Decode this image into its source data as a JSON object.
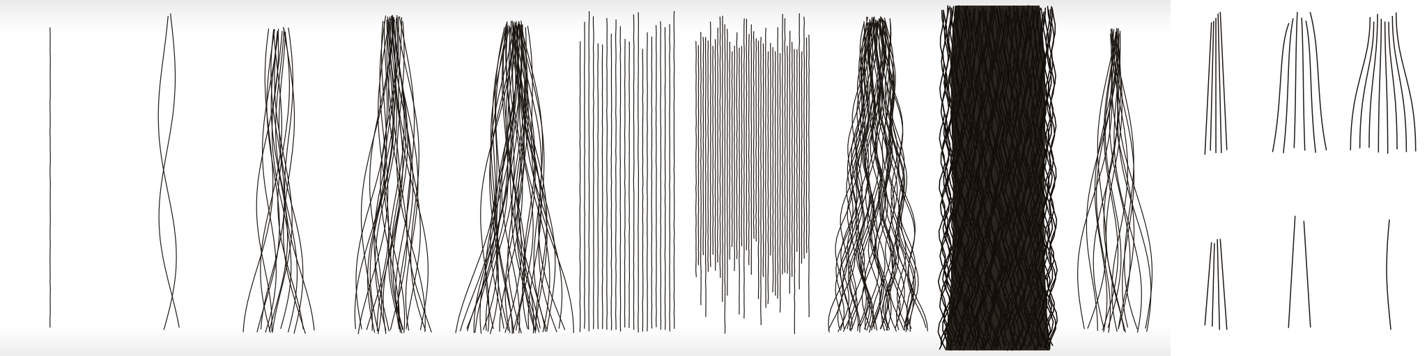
{
  "figure": {
    "background": "#ffffff",
    "ink": "#1c1712",
    "main_panel": {
      "columns": [
        {
          "name": "single-straight-strand",
          "strands": 1,
          "wave": 0,
          "spread": 0,
          "tip_taper": 0.0,
          "density": "single"
        },
        {
          "name": "single-wavy-strand",
          "strands": 2,
          "wave": 1,
          "spread": 0.05,
          "tip_taper": 0.0,
          "density": "sparse"
        },
        {
          "name": "wavy-bundle-sparse",
          "strands": 14,
          "wave": 1,
          "spread": 0.55,
          "tip_taper": 0.75,
          "density": "sparse"
        },
        {
          "name": "wavy-bundle-medium",
          "strands": 26,
          "wave": 1,
          "spread": 0.75,
          "tip_taper": 0.8,
          "density": "medium"
        },
        {
          "name": "wavy-bundle-dense",
          "strands": 40,
          "wave": 1,
          "spread": 0.85,
          "tip_taper": 0.85,
          "density": "dense"
        },
        {
          "name": "straight-bundle-long",
          "strands": 22,
          "wave": 0,
          "spread": 0.9,
          "tip_taper": 0.0,
          "density": "medium"
        },
        {
          "name": "straight-bundle-short",
          "strands": 48,
          "wave": 0,
          "spread": 0.9,
          "tip_taper": 0.0,
          "density": "dense"
        },
        {
          "name": "curly-bundle",
          "strands": 48,
          "wave": 2,
          "spread": 0.85,
          "tip_taper": 0.75,
          "density": "dense"
        },
        {
          "name": "kinky-bundle",
          "strands": 80,
          "wave": 3,
          "spread": 1.0,
          "tip_taper": 0.0,
          "density": "very-dense"
        },
        {
          "name": "root-fanning-bundle",
          "strands": 18,
          "wave": 1,
          "spread": 0.8,
          "tip_taper": 0.95,
          "density": "sparse"
        }
      ]
    },
    "side_panel": {
      "thumbnails": [
        {
          "name": "thumb-straight-few",
          "strands": 5,
          "shape": "straight"
        },
        {
          "name": "thumb-bulged-curves",
          "strands": 6,
          "shape": "bulge"
        },
        {
          "name": "thumb-fanned-curves",
          "strands": 8,
          "shape": "fan"
        },
        {
          "name": "thumb-short-straight",
          "strands": 4,
          "shape": "straight"
        },
        {
          "name": "thumb-two-strands",
          "strands": 2,
          "shape": "straight"
        },
        {
          "name": "thumb-one-strand",
          "strands": 1,
          "shape": "curve"
        }
      ]
    }
  }
}
